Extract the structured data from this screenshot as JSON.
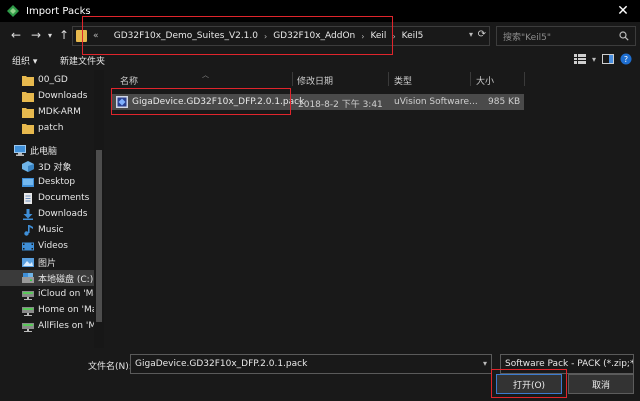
{
  "window": {
    "title": "Import Packs",
    "close_glyph": "✕"
  },
  "nav": {
    "back_glyph": "←",
    "forward_glyph": "→",
    "dropdown_glyph": "▾",
    "up_glyph": "↑",
    "crumb_prefix": "«",
    "breadcrumbs": [
      "GD32F10x_Demo_Suites_V2.1.0",
      "GD32F10x_AddOn",
      "Keil",
      "Keil5"
    ],
    "search_placeholder": "搜索\"Keil5\""
  },
  "toolbar": {
    "organize": "组织 ▾",
    "new_folder": "新建文件夹"
  },
  "sidebar": {
    "items": [
      {
        "label": "00_GD",
        "icon": "folder-icon"
      },
      {
        "label": "Downloads",
        "icon": "folder-icon"
      },
      {
        "label": "MDK-ARM",
        "icon": "folder-icon"
      },
      {
        "label": "patch",
        "icon": "folder-icon"
      },
      {
        "label": "此电脑",
        "icon": "computer-icon"
      },
      {
        "label": "3D 对象",
        "icon": "3d-objects-icon"
      },
      {
        "label": "Desktop",
        "icon": "desktop-icon"
      },
      {
        "label": "Documents",
        "icon": "documents-icon"
      },
      {
        "label": "Downloads",
        "icon": "downloads-icon"
      },
      {
        "label": "Music",
        "icon": "music-icon"
      },
      {
        "label": "Videos",
        "icon": "videos-icon"
      },
      {
        "label": "图片",
        "icon": "pictures-icon"
      },
      {
        "label": "本地磁盘 (C:)",
        "icon": "drive-icon"
      },
      {
        "label": "iCloud on 'Mac",
        "icon": "network-drive-icon"
      },
      {
        "label": "Home on 'Mac",
        "icon": "network-drive-icon"
      },
      {
        "label": "AllFiles on 'Mac",
        "icon": "network-drive-icon"
      }
    ]
  },
  "columns": {
    "name": "名称",
    "modified": "修改日期",
    "type": "类型",
    "size": "大小"
  },
  "files": [
    {
      "name": "GigaDevice.GD32F10x_DFP.2.0.1.pack",
      "modified": "2018-8-2 下午 3:41",
      "type": "uVision Software...",
      "size": "985 KB"
    }
  ],
  "bottom": {
    "filename_label": "文件名(N):",
    "filename_value": "GigaDevice.GD32F10x_DFP.2.0.1.pack",
    "filetype_value": "Software Pack - PACK (*.zip;*.pack)",
    "open_label": "打开(O)",
    "cancel_label": "取消"
  },
  "colors": {
    "background": "#191919",
    "selection": "#4a4a4a",
    "highlight_box": "#e0252c",
    "folder": "#e7b94e"
  }
}
